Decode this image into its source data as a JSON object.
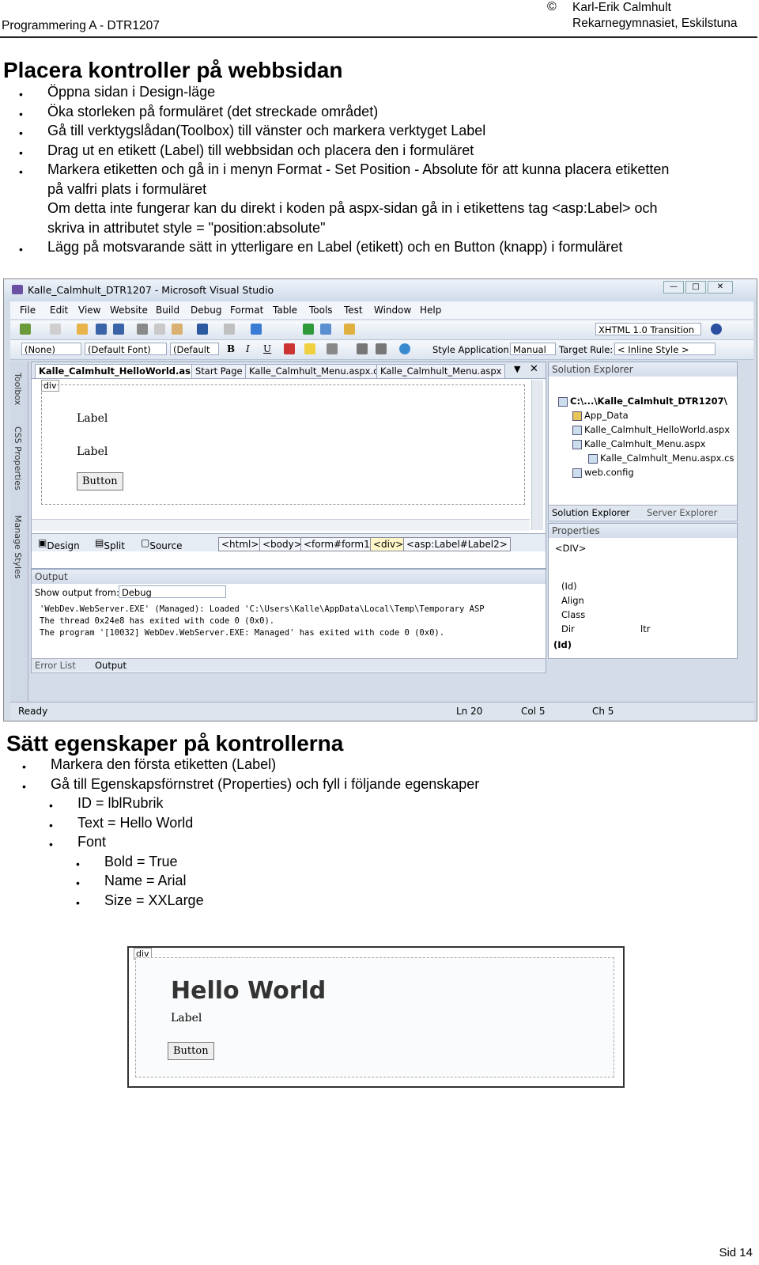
{
  "header": {
    "course": "Programmering A - DTR1207",
    "copyright": "©",
    "author": "Karl-Erik Calmhult",
    "school": "Rekarnegymnasiet, Eskilstuna"
  },
  "section1": {
    "title": "Placera kontroller på webbsidan",
    "bullets": [
      "Öppna sidan i Design-läge",
      "Öka storleken på formuläret (det streckade området)",
      "Gå till verktygslådan(Toolbox) till vänster och markera verktyget Label",
      "Drag ut en etikett (Label) till webbsidan och placera den i formuläret",
      "Markera etiketten och gå in i menyn Format - Set Position - Absolute för att kunna placera etiketten",
      "på valfri plats i formuläret",
      "Om detta inte fungerar kan du direkt i koden på aspx-sidan gå in i etikettens tag <asp:Label> och",
      "skriva in attributet style = \"position:absolute\"",
      "Lägg på motsvarande sätt in ytterligare en Label (etikett) och en Button (knapp) i formuläret"
    ]
  },
  "vs": {
    "title": "Kalle_Calmhult_DTR1207 - Microsoft Visual Studio",
    "menu": [
      "File",
      "Edit",
      "View",
      "Website",
      "Build",
      "Debug",
      "Format",
      "Table",
      "Tools",
      "Test",
      "Window",
      "Help"
    ],
    "xhtml": "XHTML 1.0 Transition",
    "combo_none": "(None)",
    "combo_font": "(Default Font)",
    "combo_default": "(Default",
    "style_app_label": "Style Application:",
    "style_app_value": "Manual",
    "target_rule_label": "Target Rule:",
    "target_rule_value": "< Inline Style >",
    "side_tabs": [
      "Toolbox",
      "CSS Properties",
      "Manage Styles"
    ],
    "tabs": [
      "Kalle_Calmhult_HelloWorld.aspx*",
      "Start Page",
      "Kalle_Calmhult_Menu.aspx.cs",
      "Kalle_Calmhult_Menu.aspx"
    ],
    "div_tag": "div",
    "label1": "Label",
    "label2": "Label",
    "button": "Button",
    "views": [
      "Design",
      "Split",
      "Source"
    ],
    "crumbs": [
      "<html>",
      "<body>",
      "<form#form1>",
      "<div>",
      "<asp:Label#Label2>"
    ],
    "output_title": "Output",
    "output_from_label": "Show output from:",
    "output_from_value": "Debug",
    "output_lines": [
      "'WebDev.WebServer.EXE' (Managed): Loaded 'C:\\Users\\Kalle\\AppData\\Local\\Temp\\Temporary ASP",
      "The thread 0x24e8 has exited with code 0 (0x0).",
      "The program '[10032] WebDev.WebServer.EXE: Managed' has exited with code 0 (0x0)."
    ],
    "bottom_tabs": [
      "Error List",
      "Output"
    ],
    "status": {
      "ready": "Ready",
      "ln": "Ln 20",
      "col": "Col 5",
      "ch": "Ch 5"
    },
    "solution_title": "Solution Explorer",
    "solution_items": [
      "C:\\...\\Kalle_Calmhult_DTR1207\\",
      "App_Data",
      "Kalle_Calmhult_HelloWorld.aspx",
      "Kalle_Calmhult_Menu.aspx",
      "Kalle_Calmhult_Menu.aspx.cs",
      "web.config"
    ],
    "solution_tabs": [
      "Solution Explorer",
      "Server Explorer"
    ],
    "properties_title": "Properties",
    "properties_object": "<DIV>",
    "properties_rows": [
      "(Id)",
      "Align",
      "Class",
      "Dir"
    ],
    "properties_dir_value": "ltr",
    "properties_desc": "(Id)"
  },
  "section2": {
    "title": "Sätt egenskaper på kontrollerna",
    "bullets": [
      "Markera den första etiketten (Label)",
      "Gå till Egenskapsförnstret (Properties) och fyll i följande egenskaper"
    ],
    "props": [
      "ID = lblRubrik",
      "Text = Hello World",
      "Font"
    ],
    "font_props": [
      "Bold = True",
      "Name = Arial",
      "Size = XXLarge"
    ]
  },
  "preview": {
    "div_tag": "div",
    "heading": "Hello World",
    "label": "Label",
    "button": "Button"
  },
  "page_number": "Sid 14"
}
